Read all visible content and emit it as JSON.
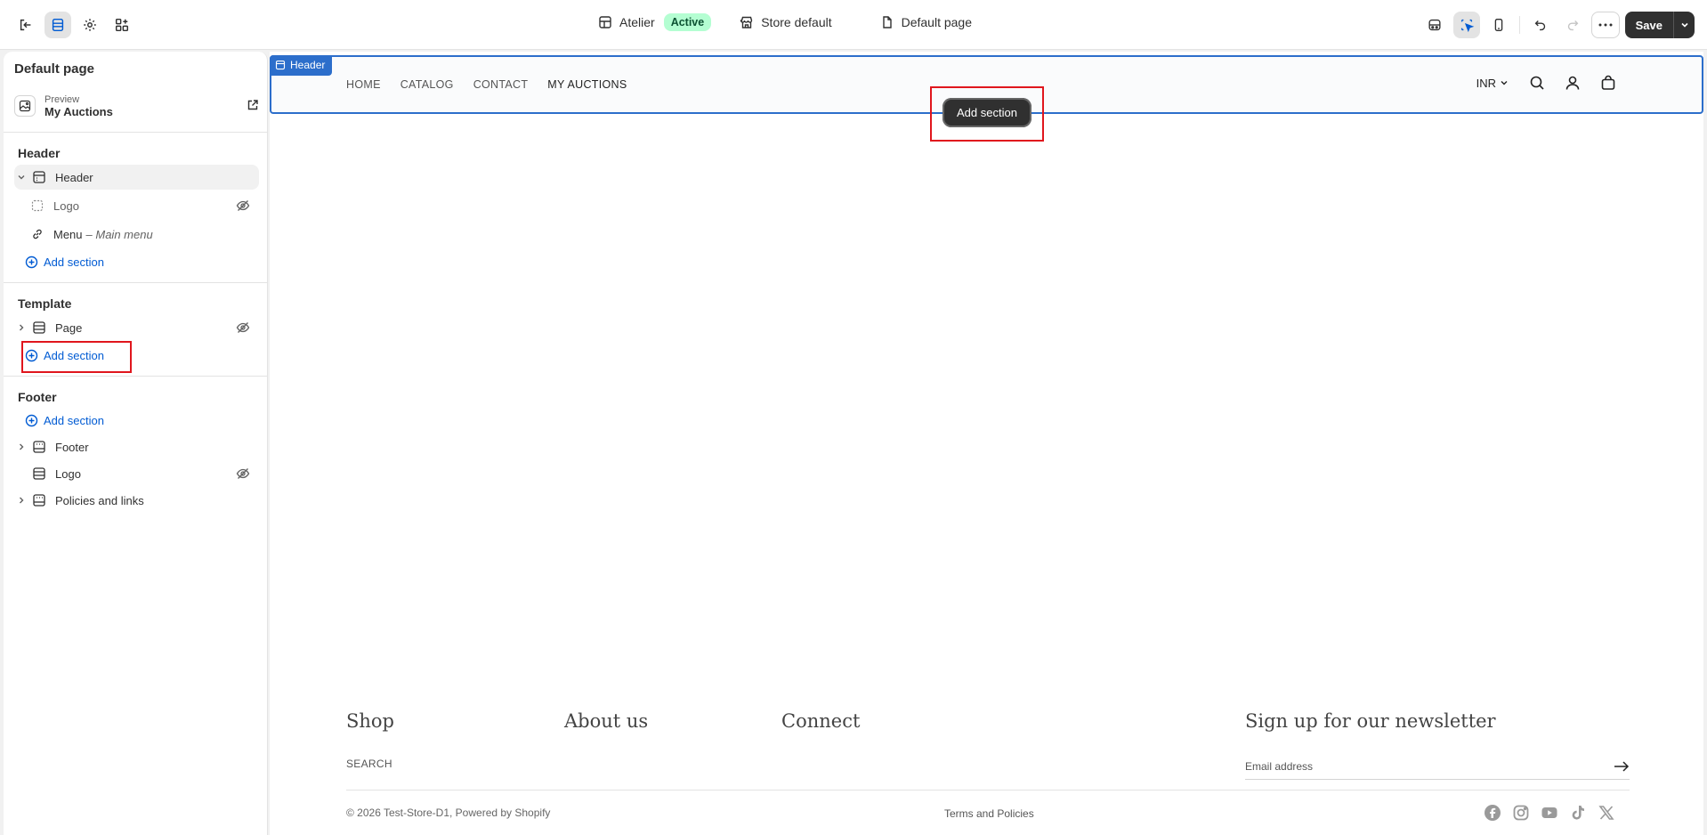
{
  "topbar": {
    "theme_name": "Atelier",
    "theme_status": "Active",
    "store": "Store default",
    "page": "Default page",
    "save_label": "Save"
  },
  "sidebar": {
    "title": "Default page",
    "preview_label": "Preview",
    "preview_value": "My Auctions",
    "header_group": "Header",
    "header_item": "Header",
    "logo_item": "Logo",
    "menu_item": "Menu",
    "menu_sub": "– Main menu",
    "add_section": "Add section",
    "template_group": "Template",
    "page_item": "Page",
    "footer_group": "Footer",
    "footer_item": "Footer",
    "footer_logo": "Logo",
    "policies_item": "Policies and links"
  },
  "canvas": {
    "header_tag": "Header",
    "nav": [
      "HOME",
      "CATALOG",
      "CONTACT",
      "MY AUCTIONS"
    ],
    "currency": "INR",
    "add_section_pill": "Add section",
    "footer": {
      "col1": "Shop",
      "col2": "About us",
      "col3": "Connect",
      "search": "SEARCH",
      "newsletter": "Sign up for our newsletter",
      "email_placeholder": "Email address",
      "copyright": "© 2026 Test-Store-D1, Powered by Shopify",
      "terms": "Terms and Policies"
    }
  },
  "colors": {
    "accent": "#005bd3",
    "selection": "#2c6ecb",
    "highlight": "#e0161d",
    "active_badge": "#b4fed2"
  }
}
